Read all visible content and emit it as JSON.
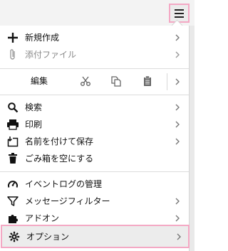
{
  "menu_button": {
    "icon": "hamburger-menu-icon"
  },
  "menu": {
    "new": {
      "label": "新規作成",
      "icon": "plus-icon"
    },
    "attach": {
      "label": "添付ファイル",
      "icon": "paperclip-icon"
    },
    "edit": {
      "label": "編集",
      "cut_icon": "scissors-icon",
      "copy_icon": "copy-icon",
      "paste_icon": "clipboard-icon"
    },
    "search": {
      "label": "検索",
      "icon": "magnifier-icon"
    },
    "print": {
      "label": "印刷",
      "icon": "printer-icon"
    },
    "save_as": {
      "label": "名前を付けて保存",
      "icon": "save-icon"
    },
    "empty_trash": {
      "label": "ごみ箱を空にする",
      "icon": "trash-icon"
    },
    "event_log": {
      "label": "イベントログの管理",
      "icon": "gauge-icon"
    },
    "message_filter": {
      "label": "メッセージフィルター",
      "icon": "filter-icon"
    },
    "addons": {
      "label": "アドオン",
      "icon": "puzzle-icon"
    },
    "options": {
      "label": "オプション",
      "icon": "gear-icon"
    }
  }
}
